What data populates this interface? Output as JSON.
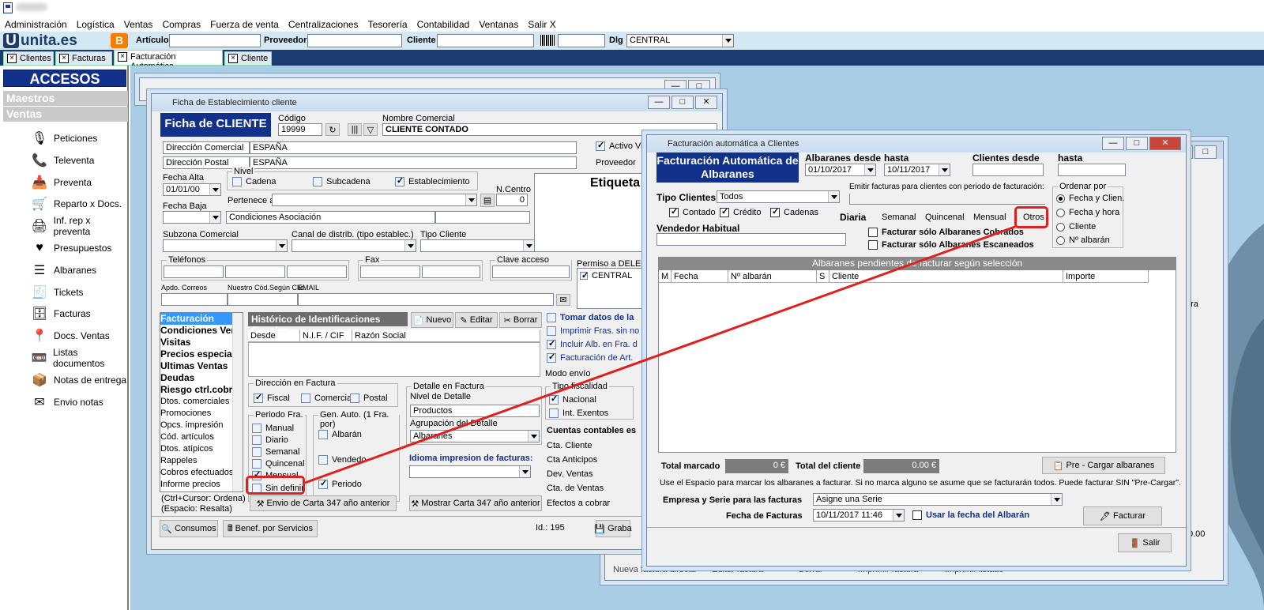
{
  "menu": [
    "Administración",
    "Logística",
    "Ventas",
    "Compras",
    "Fuerza de venta",
    "Centralizaciones",
    "Tesorería",
    "Contabilidad",
    "Ventanas",
    "Salir X"
  ],
  "toolbar": {
    "logo": "unita.es",
    "blogger": "B",
    "articulo": "Artículo",
    "proveedor": "Proveedor",
    "cliente": "Cliente",
    "dlg": "Dlg",
    "dlg_value": "CENTRAL"
  },
  "tabs": [
    "Clientes",
    "Facturas",
    "Facturación Automática",
    "Cliente"
  ],
  "sidebar": {
    "title": "ACCESOS RAPIDOS",
    "maestros": "Maestros",
    "ventas": "Ventas",
    "items": [
      {
        "label": "Peticiones",
        "icon": "microphone-icon"
      },
      {
        "label": "Televenta",
        "icon": "phone-icon"
      },
      {
        "label": "Preventa",
        "icon": "inbox-icon"
      },
      {
        "label": "Reparto x Docs.",
        "icon": "cart-icon"
      },
      {
        "label": "Inf. rep x preventa",
        "icon": "printer-icon"
      },
      {
        "label": "Presupuestos",
        "icon": "heart-icon"
      },
      {
        "label": "Albaranes",
        "icon": "list-icon"
      },
      {
        "label": "Tickets",
        "icon": "receipt-icon"
      },
      {
        "label": "Facturas",
        "icon": "cabinet-icon"
      },
      {
        "label": "Docs. Ventas",
        "icon": "pin-icon"
      },
      {
        "label": "Listas documentos",
        "icon": "tape-icon"
      },
      {
        "label": "Notas de entrega",
        "icon": "box-icon"
      },
      {
        "label": "Envio notas",
        "icon": "mail-icon"
      }
    ]
  },
  "ficha": {
    "window_title": "Ficha de Establecimiento cliente",
    "heading": "Ficha de CLIENTE",
    "codigo_label": "Código",
    "codigo": "19999",
    "nombre_label": "Nombre Comercial",
    "nombre": "CLIENTE CONTADO",
    "dir_comercial": "Dirección Comercial",
    "pais1": "ESPAÑA",
    "dir_postal": "Dirección Postal",
    "pais2": "ESPAÑA",
    "activo": "Activo Vi",
    "proveedor": "Proveedor",
    "fecha_alta_label": "Fecha Alta",
    "fecha_alta": "01/01/00",
    "fecha_baja_label": "Fecha Baja",
    "nivel": "Nivel",
    "cadena": "Cadena",
    "subcadena": "Subcadena",
    "establecimiento": "Establecimiento",
    "ncentro": "N.Centro",
    "ncentro_val": "0",
    "etiqueta": "Etiqueta",
    "pertenece": "Pertenece a",
    "cond_asoc": "Condiciones Asociación",
    "subzona": "Subzona Comercial",
    "canal": "Canal de distrib. (tipo establec.)",
    "tipo_cliente": "Tipo Cliente",
    "telefonos": "Teléfonos",
    "fax": "Fax",
    "clave": "Clave acceso Internet",
    "permiso": "Permiso a DELEGA",
    "permiso_val": "CENTRAL",
    "apdo": "Apdo. Correos",
    "nuestro": "Nuestro Cód.Según Clie.",
    "email": "EMAIL",
    "left_list": [
      {
        "t": "Facturación",
        "k": "sel b"
      },
      {
        "t": "Condiciones Vent",
        "k": "b"
      },
      {
        "t": "Visitas",
        "k": "b"
      },
      {
        "t": "Precios especiale",
        "k": "b"
      },
      {
        "t": "Ultimas Ventas",
        "k": "b"
      },
      {
        "t": "Deudas",
        "k": "b"
      },
      {
        "t": "Riesgo ctrl.cobro",
        "k": "b"
      },
      {
        "t": "Dtos. comerciales",
        "k": ""
      },
      {
        "t": "Promociones",
        "k": ""
      },
      {
        "t": "Opcs. impresión",
        "k": ""
      },
      {
        "t": "Cód. artículos",
        "k": ""
      },
      {
        "t": "Dtos. atípicos",
        "k": ""
      },
      {
        "t": "Rappeles",
        "k": ""
      },
      {
        "t": "Cobros efectuados",
        "k": ""
      },
      {
        "t": "Informe precios",
        "k": ""
      }
    ],
    "ctrl_note": "(Ctrl+Cursor: Ordena)",
    "esp_note": "(Espacio: Resalta)",
    "historico": "Histórico de Identificaciones Fiscales",
    "nuevo": "Nuevo",
    "editar": "Editar",
    "borrar": "Borrar",
    "col_desde": "Desde",
    "col_nif": "N.I.F. / CIF",
    "col_razon": "Razón Social",
    "dir_factura": "Dirección en Factura",
    "fiscal": "Fiscal",
    "comercial": "Comercia",
    "postal": "Postal",
    "periodo": "Periodo Fra.",
    "manual": "Manual",
    "diario": "Diario",
    "semanal": "Semanal",
    "quincenal": "Quincenal",
    "mensual": "Mensual",
    "sin_definir": "Sin definir",
    "gen_auto": "Gen. Auto. (1 Fra. por)",
    "albaran": "Albarán",
    "vendedor": "Vendedo",
    "periodo2": "Periodo",
    "detalle": "Detalle en Factura",
    "nivel_det": "Nivel de Detalle",
    "productos": "Productos",
    "agrup": "Agrupación del Detalle",
    "albaranes": "Albaranes",
    "idioma": "Idioma impresion de facturas:",
    "tomar": "Tomar datos de la",
    "imprimir": "Imprimir Fras. sin no",
    "incluir": "Incluir Alb. en Fra. d",
    "facturacion_art": "Facturación de Art.",
    "modo_envio": "Modo envío",
    "tipo_fiscal": "Tipo fiscalidad",
    "nacional": "Nacional",
    "int_exentos": "Int. Exentos",
    "cuentas": "Cuentas contables es",
    "cta_cliente": "Cta. Cliente",
    "cta_anticipos": "Cta Anticipos",
    "dev_ventas": "Dev. Ventas",
    "cta_ventas": "Cta. de Ventas",
    "efectos": "Efectos a cobrar",
    "envio_carta": "Envio de Carta 347 año anterior",
    "mostrar_carta": "Mostrar Carta 347 año anterior",
    "consumos": "Consumos",
    "benef": "Benef. por Servicios",
    "id": "Id.: 195",
    "grabar": "Graba"
  },
  "fact": {
    "window_title": "Facturación automática a Clientes",
    "heading": "Facturación Automática de Albaranes",
    "alb_desde": "Albaranes desde",
    "hasta": "hasta",
    "desde_val": "01/10/2017",
    "hasta_val": "10/11/2017",
    "cli_desde": "Clientes desde",
    "hasta2": "hasta",
    "tipo_clientes": "Tipo Clientes",
    "todos": "Todos",
    "contado": "Contado",
    "credito": "Crédito",
    "cadenas": "Cadenas",
    "emitir": "Emitir facturas para clientes con periodo de facturación:",
    "diaria": "Diaria",
    "semanal": "Semanal",
    "quincenal": "Quincenal",
    "mensual": "Mensual",
    "otros": "Otros",
    "vendedor": "Vendedor Habitual",
    "solo_cobrados": "Facturar sólo Albaranes Cobrados",
    "solo_escaneados": "Facturar sólo Albaranes Escaneados",
    "ordenar": "Ordenar por",
    "ord1": "Fecha y Clien.",
    "ord2": "Fecha y hora",
    "ord3": "Cliente",
    "ord4": "Nº albarán",
    "pendientes": "Albaranes pendientes de facturar según selección",
    "cols": [
      "M",
      "Fecha",
      "Nº albarán",
      "S",
      "Cliente",
      "Importe"
    ],
    "total_marcado": "Total marcado",
    "total_marcado_val": "0 €",
    "total_cliente": "Total del cliente",
    "total_cliente_val": "0.00 €",
    "precargar": "Pre - Cargar albaranes",
    "nota": "Use el Espacio para marcar los albaranes a facturar. Si no marca alguno se asume que se facturarán todos.  Puede facturar SIN \"Pre-Cargar\".",
    "empresa": "Empresa y Serie para las facturas",
    "asigne": "Asigne una Serie",
    "fecha_fact": "Fecha de Facturas",
    "fecha_fact_val": "10/11/2017 11:46",
    "usar_fecha": "Usar la fecha del Albarán",
    "facturar": "Facturar",
    "salir": "Salir"
  },
  "back": {
    "pera": "era",
    "total": "0.00",
    "nueva": "Nueva factura directa",
    "col2": "Editar factura",
    "col3": "Borrar",
    "col4": "Imprimir factura",
    "col5": "Imprimir listado"
  },
  "colors": {
    "annotation": "#e02020",
    "navy": "#12318a",
    "desktop": "#a9cde4"
  }
}
